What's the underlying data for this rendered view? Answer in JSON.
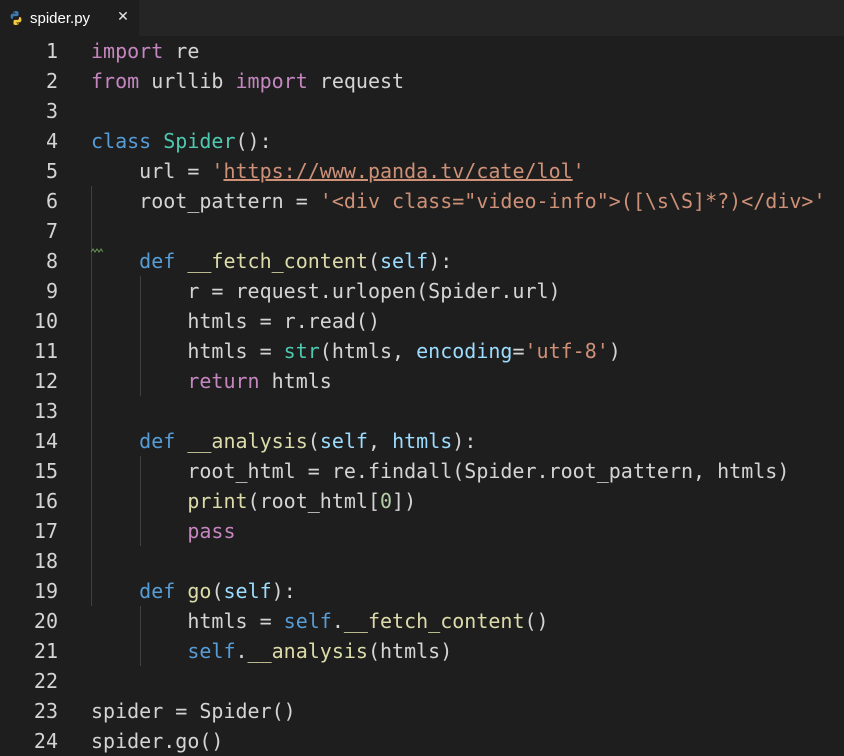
{
  "tab": {
    "title": "spider.py",
    "close_glyph": "✕",
    "icon": "python-file-icon"
  },
  "colors": {
    "background": "#1e1e1e",
    "keyword_blue": "#569cd6",
    "keyword_pink": "#c586c0",
    "class_name": "#4ec9b0",
    "function": "#dcdcaa",
    "string": "#ce9178",
    "parameter": "#9cdcfe",
    "number": "#b5cea8",
    "text": "#d4d4d4"
  },
  "lines": [
    {
      "num": "1",
      "tokens": [
        {
          "t": "import",
          "c": "kw-pink"
        },
        {
          "t": " re",
          "c": ""
        }
      ]
    },
    {
      "num": "2",
      "tokens": [
        {
          "t": "from",
          "c": "kw-pink"
        },
        {
          "t": " urllib ",
          "c": ""
        },
        {
          "t": "import",
          "c": "kw-pink"
        },
        {
          "t": " request",
          "c": ""
        }
      ]
    },
    {
      "num": "3",
      "tokens": []
    },
    {
      "num": "4",
      "tokens": [
        {
          "t": "class",
          "c": "kw-blue"
        },
        {
          "t": " ",
          "c": ""
        },
        {
          "t": "Spider",
          "c": "cls"
        },
        {
          "t": "():",
          "c": ""
        }
      ]
    },
    {
      "num": "5",
      "tokens": [
        {
          "t": "    url = ",
          "c": ""
        },
        {
          "t": "'",
          "c": "str"
        },
        {
          "t": "https://www.panda.tv/cate/lol",
          "c": "url"
        },
        {
          "t": "'",
          "c": "str"
        }
      ]
    },
    {
      "num": "6",
      "tokens": [
        {
          "t": "    root_pattern = ",
          "c": ""
        },
        {
          "t": "'<div class=\"video-info\">([\\s\\S]*?)</div>'",
          "c": "str"
        }
      ]
    },
    {
      "num": "7",
      "tokens": []
    },
    {
      "num": "8",
      "tokens": [
        {
          "t": "    ",
          "c": ""
        },
        {
          "t": "def",
          "c": "kw-blue"
        },
        {
          "t": " ",
          "c": ""
        },
        {
          "t": "__fetch_content",
          "c": "fn"
        },
        {
          "t": "(",
          "c": ""
        },
        {
          "t": "self",
          "c": "param"
        },
        {
          "t": "):",
          "c": ""
        }
      ]
    },
    {
      "num": "9",
      "tokens": [
        {
          "t": "        r = request.urlopen(Spider.url)",
          "c": ""
        }
      ]
    },
    {
      "num": "10",
      "tokens": [
        {
          "t": "        htmls = r.read()",
          "c": ""
        }
      ]
    },
    {
      "num": "11",
      "tokens": [
        {
          "t": "        htmls = ",
          "c": ""
        },
        {
          "t": "str",
          "c": "cls"
        },
        {
          "t": "(htmls, ",
          "c": ""
        },
        {
          "t": "encoding",
          "c": "param"
        },
        {
          "t": "=",
          "c": ""
        },
        {
          "t": "'utf-8'",
          "c": "str"
        },
        {
          "t": ")",
          "c": ""
        }
      ]
    },
    {
      "num": "12",
      "tokens": [
        {
          "t": "        ",
          "c": ""
        },
        {
          "t": "return",
          "c": "kw-pink"
        },
        {
          "t": " htmls",
          "c": ""
        }
      ]
    },
    {
      "num": "13",
      "tokens": []
    },
    {
      "num": "14",
      "tokens": [
        {
          "t": "    ",
          "c": ""
        },
        {
          "t": "def",
          "c": "kw-blue"
        },
        {
          "t": " ",
          "c": ""
        },
        {
          "t": "__analysis",
          "c": "fn"
        },
        {
          "t": "(",
          "c": ""
        },
        {
          "t": "self",
          "c": "param"
        },
        {
          "t": ", ",
          "c": ""
        },
        {
          "t": "htmls",
          "c": "param"
        },
        {
          "t": "):",
          "c": ""
        }
      ]
    },
    {
      "num": "15",
      "tokens": [
        {
          "t": "        root_html = re.findall(Spider.root_pattern, htmls)",
          "c": ""
        }
      ]
    },
    {
      "num": "16",
      "tokens": [
        {
          "t": "        ",
          "c": ""
        },
        {
          "t": "print",
          "c": "fn"
        },
        {
          "t": "(root_html[",
          "c": ""
        },
        {
          "t": "0",
          "c": "num"
        },
        {
          "t": "])",
          "c": ""
        }
      ]
    },
    {
      "num": "17",
      "tokens": [
        {
          "t": "        ",
          "c": ""
        },
        {
          "t": "pass",
          "c": "kw-pink"
        }
      ]
    },
    {
      "num": "18",
      "tokens": []
    },
    {
      "num": "19",
      "tokens": [
        {
          "t": "    ",
          "c": ""
        },
        {
          "t": "def",
          "c": "kw-blue"
        },
        {
          "t": " ",
          "c": ""
        },
        {
          "t": "go",
          "c": "fn"
        },
        {
          "t": "(",
          "c": ""
        },
        {
          "t": "self",
          "c": "param"
        },
        {
          "t": "):",
          "c": ""
        }
      ]
    },
    {
      "num": "20",
      "tokens": [
        {
          "t": "        htmls = ",
          "c": ""
        },
        {
          "t": "self",
          "c": "kw-blue"
        },
        {
          "t": ".",
          "c": ""
        },
        {
          "t": "__fetch_content",
          "c": "fn"
        },
        {
          "t": "()",
          "c": ""
        }
      ]
    },
    {
      "num": "21",
      "tokens": [
        {
          "t": "        ",
          "c": ""
        },
        {
          "t": "self",
          "c": "kw-blue"
        },
        {
          "t": ".",
          "c": ""
        },
        {
          "t": "__analysis",
          "c": "fn"
        },
        {
          "t": "(htmls)",
          "c": ""
        }
      ]
    },
    {
      "num": "22",
      "tokens": []
    },
    {
      "num": "23",
      "tokens": [
        {
          "t": "spider = Spider()",
          "c": ""
        }
      ]
    },
    {
      "num": "24",
      "tokens": [
        {
          "t": "spider.go()",
          "c": ""
        }
      ]
    }
  ]
}
